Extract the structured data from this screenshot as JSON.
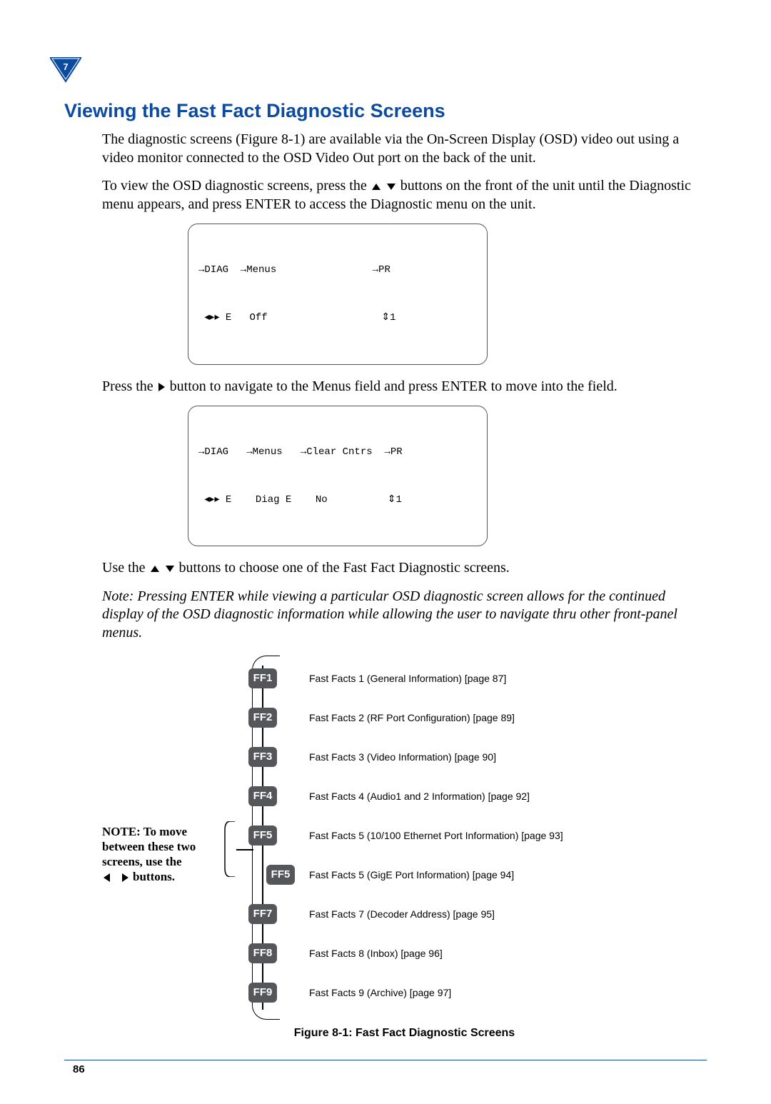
{
  "chapter": "7",
  "heading": "Viewing the Fast Fact Diagnostic Screens",
  "para1": "The diagnostic screens (Figure 8-1) are available via the On-Screen Display (OSD) video out using a video monitor connected to the OSD Video Out port on the back of the unit.",
  "para2a": "To view the OSD diagnostic screens, press the ",
  "para2b": " buttons on the front of the unit until the Diagnostic menu appears, and press ENTER to access the Diagnostic menu on the unit.",
  "lcd1": {
    "line1": "→DIAG  →Menus                →PR",
    "line2": " ◂▸▸ E   Off                   ⇕1"
  },
  "para3a": "Press the ",
  "para3b": " button to navigate to the Menus field and press ENTER to move into the field.",
  "lcd2": {
    "line1": "→DIAG   →Menus   →Clear Cntrs  →PR",
    "line2": " ◂▸▸ E    Diag E    No          ⇕1"
  },
  "para4a": "Use the ",
  "para4b": " buttons to choose one of the Fast Fact Diagnostic screens.",
  "note": "Note:   Pressing ENTER while viewing a particular OSD diagnostic screen allows for the continued display of the OSD diagnostic information while allowing the user to navigate thru other front-panel menus.",
  "sidenote_a": "NOTE:  To move between these two screens, use the",
  "sidenote_b": "buttons.",
  "fig_caption": "Figure 8-1: Fast Fact Diagnostic Screens",
  "page_number": "86",
  "nodes": [
    {
      "id": "FF1",
      "label": "Fast Facts 1 (General Information) [page 87]",
      "indent": false
    },
    {
      "id": "FF2",
      "label": "Fast Facts 2 (RF Port Configuration) [page 89]",
      "indent": false
    },
    {
      "id": "FF3",
      "label": "Fast Facts 3 (Video Information) [page 90]",
      "indent": false
    },
    {
      "id": "FF4",
      "label": "Fast Facts 4 (Audio1 and 2 Information) [page 92]",
      "indent": false
    },
    {
      "id": "FF5",
      "label": "Fast Facts 5 (10/100 Ethernet Port Information) [page 93]",
      "indent": false
    },
    {
      "id": "FF5",
      "label": "Fast Facts 5 (GigE Port Information) [page 94]",
      "indent": true
    },
    {
      "id": "FF7",
      "label": "Fast Facts 7 (Decoder Address) [page 95]",
      "indent": false
    },
    {
      "id": "FF8",
      "label": "Fast Facts 8 (Inbox) [page 96]",
      "indent": false
    },
    {
      "id": "FF9",
      "label": "Fast Facts 9 (Archive) [page 97]",
      "indent": false
    }
  ]
}
